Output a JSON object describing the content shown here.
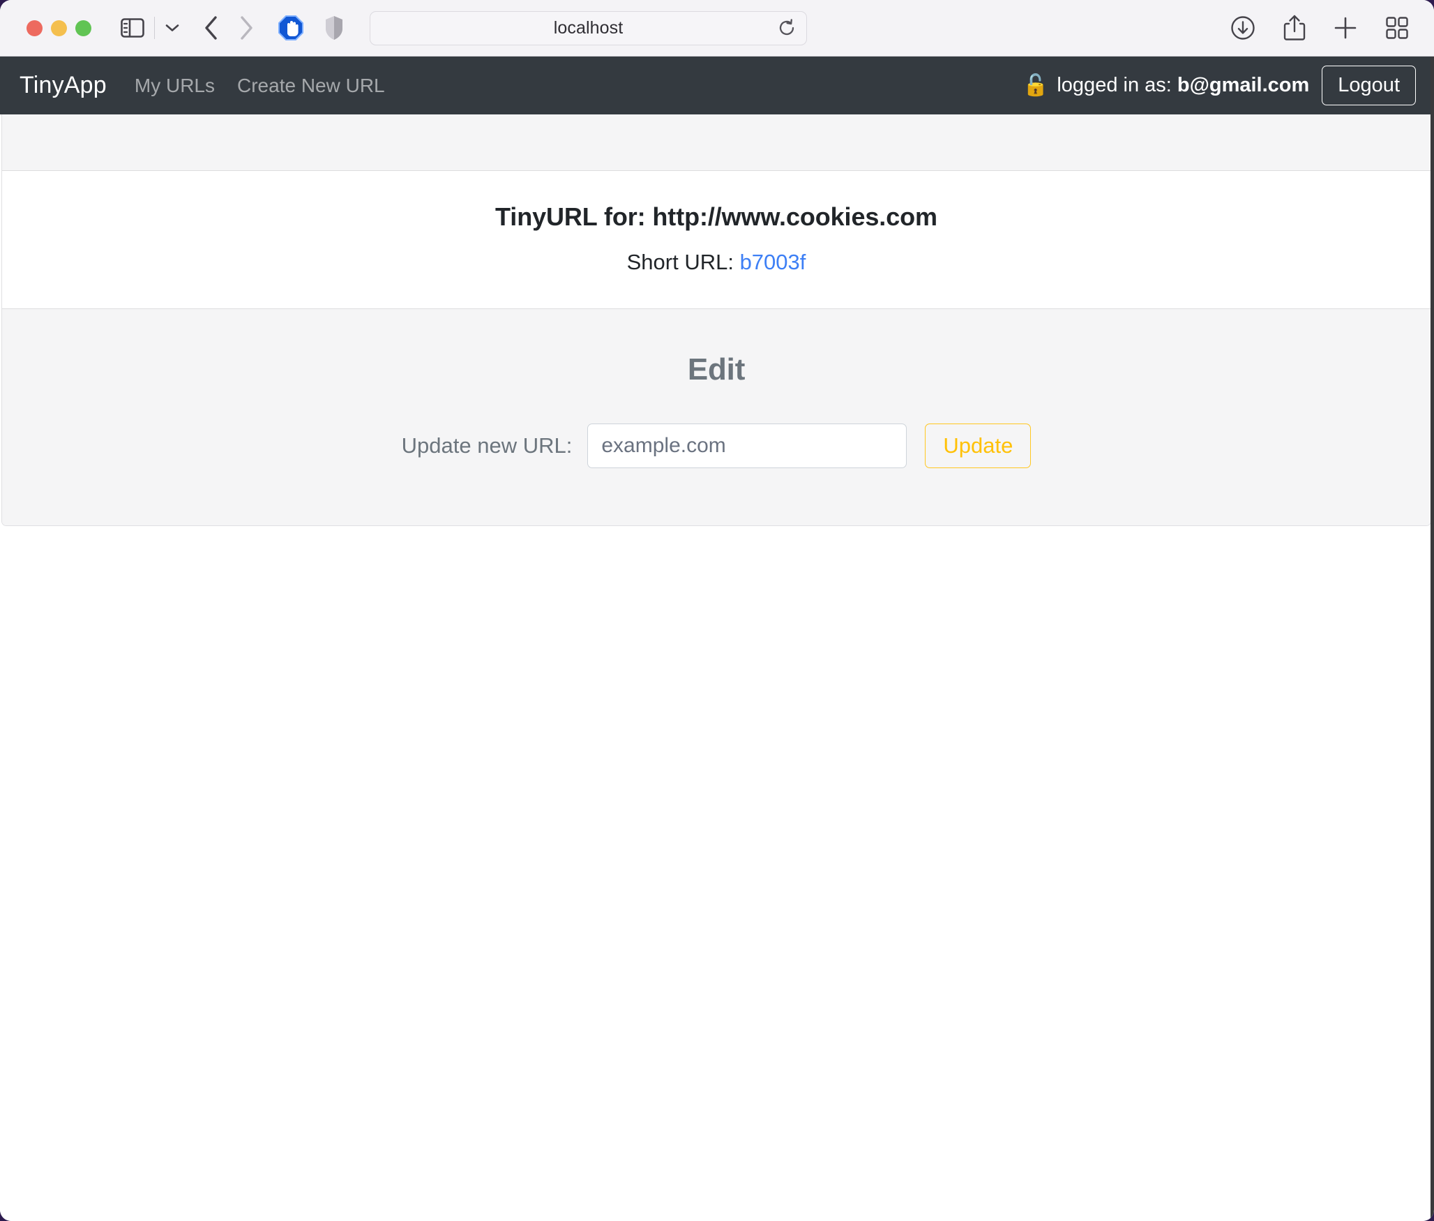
{
  "browser": {
    "url_text": "localhost",
    "traffic_lights": [
      "close-button",
      "minimize-button",
      "maximize-button"
    ],
    "left_icons": [
      "sidebar-toggle-icon",
      "sidebar-chevron-down-icon",
      "back-arrow-icon",
      "forward-arrow-icon",
      "adblock-icon",
      "privacy-shield-icon"
    ],
    "right_icons": [
      "downloads-icon",
      "share-icon",
      "new-tab-icon",
      "tab-overview-icon"
    ],
    "reload_icon": "reload-icon"
  },
  "navbar": {
    "brand": "TinyApp",
    "links": [
      {
        "label": "My URLs"
      },
      {
        "label": "Create New URL"
      }
    ],
    "lock_icon": "🔓",
    "logged_in_prefix": "logged in as: ",
    "logged_in_email": "b@gmail.com",
    "logout_label": "Logout"
  },
  "card": {
    "title": "TinyURL for: http://www.cookies.com",
    "short_url_label": "Short URL: ",
    "short_url_value": "b7003f",
    "edit_heading": "Edit",
    "form": {
      "label": "Update new URL:",
      "input_value": "",
      "input_placeholder": "example.com",
      "submit_label": "Update"
    }
  },
  "colors": {
    "navbar_bg": "#343a40",
    "link_blue": "#3d7ff5",
    "warning": "#ffc107",
    "muted": "#6c757d"
  }
}
